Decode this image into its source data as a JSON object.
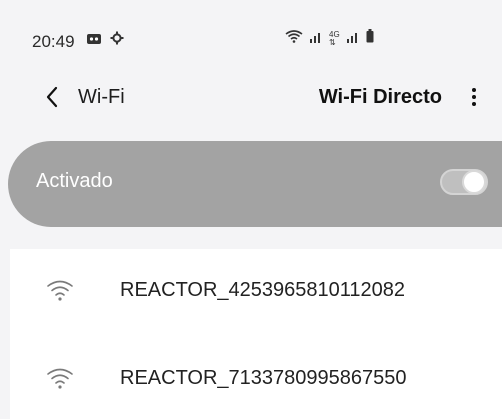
{
  "status_bar": {
    "time": "20:49",
    "left_icons": [
      "media-icon",
      "settings-icon"
    ],
    "right_icons": [
      "wifi-icon",
      "signal-icon",
      "4g-icon",
      "signal-icon",
      "battery-icon"
    ],
    "network_type": "4G"
  },
  "header": {
    "back_label": "Wi-Fi",
    "wifi_direct_label": "Wi-Fi Directo",
    "more_icon": "more-vertical-icon"
  },
  "master_switch": {
    "label": "Activado",
    "state": "on"
  },
  "networks": [
    {
      "ssid": "REACTOR_4253965810112082",
      "icon": "wifi-icon"
    },
    {
      "ssid": "REACTOR_7133780995867550",
      "icon": "wifi-icon"
    }
  ],
  "colors": {
    "background": "#f4f4f6",
    "master_bg": "#a3a3a3",
    "list_bg": "#ffffff",
    "text": "#202020"
  }
}
